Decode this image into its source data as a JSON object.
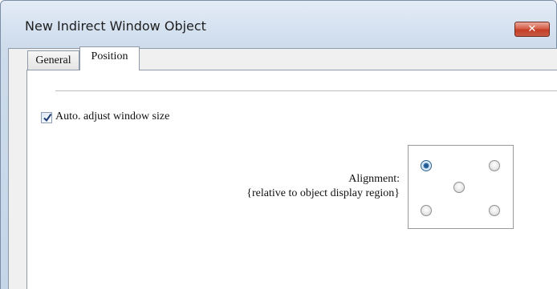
{
  "window": {
    "title": "New Indirect Window Object",
    "close_glyph": "✕"
  },
  "tabs": [
    {
      "label": "General",
      "active": false
    },
    {
      "label": "Position",
      "active": true
    }
  ],
  "position_tab": {
    "auto_adjust": {
      "label": "Auto. adjust window size",
      "checked": true
    },
    "alignment": {
      "label_line1": "Alignment:",
      "label_line2": "{relative to object display region}",
      "options": [
        {
          "id": "top-left",
          "selected": true
        },
        {
          "id": "top-right",
          "selected": false
        },
        {
          "id": "center",
          "selected": false
        },
        {
          "id": "bottom-left",
          "selected": false
        },
        {
          "id": "bottom-right",
          "selected": false
        }
      ]
    }
  },
  "colors": {
    "close_button": "#c43d26",
    "radio_selected": "#2f6ca5",
    "checkbox_check": "#1c3c73"
  }
}
